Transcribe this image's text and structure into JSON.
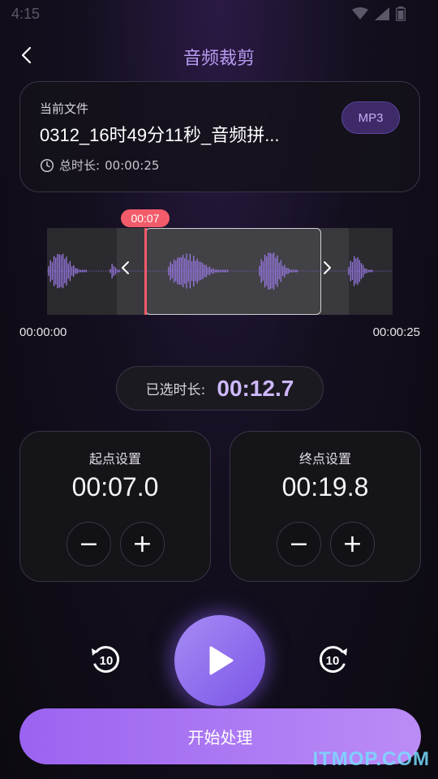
{
  "status_bar": {
    "time": "4:15"
  },
  "header": {
    "title": "音频裁剪"
  },
  "file_card": {
    "label": "当前文件",
    "file_name": "0312_16时49分11秒_音频拼...",
    "duration_label": "总时长:",
    "duration_value": "00:00:25",
    "format": "MP3"
  },
  "waveform": {
    "playhead_time": "00:07",
    "start_time": "00:00:00",
    "end_time": "00:00:25"
  },
  "selection": {
    "label": "已选时长:",
    "value": "00:12.7"
  },
  "start_point": {
    "title": "起点设置",
    "value": "00:07.0"
  },
  "end_point": {
    "title": "终点设置",
    "value": "00:19.8"
  },
  "controls": {
    "minus": "−",
    "plus": "+",
    "rewind": "10",
    "forward": "10"
  },
  "action": {
    "label": "开始处理"
  },
  "watermark": "ITMOP.COM",
  "colors": {
    "accent": "#9a63f0",
    "playhead": "#f25c6a",
    "title": "#b99cf2"
  }
}
